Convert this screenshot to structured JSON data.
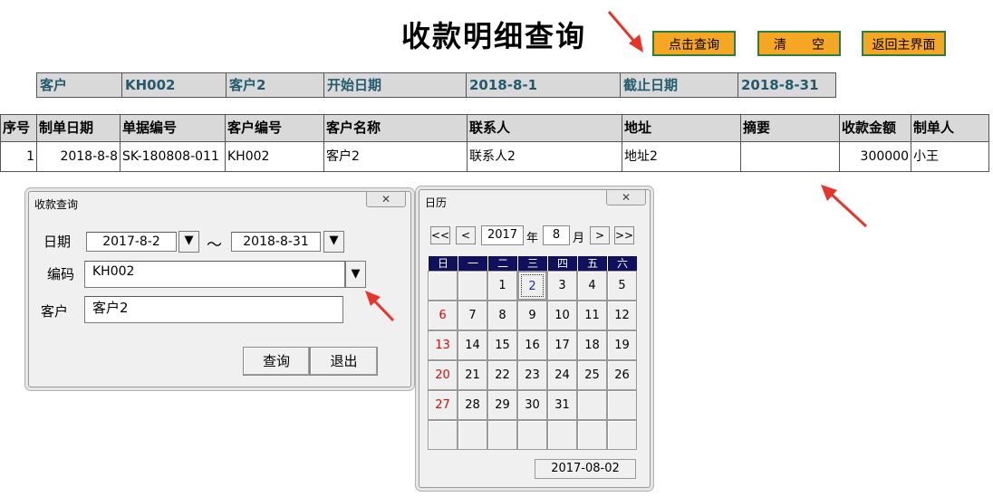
{
  "page": {
    "title": "收款明细查询",
    "buttons": {
      "query": "点击查询",
      "clear": "清　　空",
      "back": "返回主界面"
    }
  },
  "filter": [
    "客户",
    "KH002",
    "客户2",
    "开始日期",
    "2018-8-1",
    "截止日期",
    "2018-8-31"
  ],
  "table": {
    "headers": [
      "序号",
      "制单日期",
      "单据编号",
      "客户编号",
      "客户名称",
      "联系人",
      "地址",
      "摘要",
      "收款金额",
      "制单人"
    ],
    "rows": [
      [
        "1",
        "2018-8-8",
        "SK-180808-011",
        "KH002",
        "客户2",
        "联系人2",
        "地址2",
        "",
        "300000",
        "小王"
      ]
    ]
  },
  "query_dialog": {
    "title": "收款查询",
    "close": "✕",
    "date_label": "日期",
    "date_from": "2017-8-2",
    "tilde": "～",
    "date_to": "2018-8-31",
    "code_label": "编码",
    "code_value": "KH002",
    "customer_label": "客户",
    "customer_value": "客户2",
    "query_btn": "查询",
    "exit_btn": "退出",
    "dropdown_glyph": "▼"
  },
  "calendar": {
    "title": "日历",
    "close": "✕",
    "prev_year": "<<",
    "prev_month": "<",
    "year": "2017",
    "year_label": "年",
    "month": "8",
    "month_label": "月",
    "next_month": ">",
    "next_year": ">>",
    "weekdays": [
      "日",
      "一",
      "二",
      "三",
      "四",
      "五",
      "六"
    ],
    "weeks": [
      [
        "",
        "",
        "1",
        "2",
        "3",
        "4",
        "5"
      ],
      [
        "6",
        "7",
        "8",
        "9",
        "10",
        "11",
        "12"
      ],
      [
        "13",
        "14",
        "15",
        "16",
        "17",
        "18",
        "19"
      ],
      [
        "20",
        "21",
        "22",
        "23",
        "24",
        "25",
        "26"
      ],
      [
        "27",
        "28",
        "29",
        "30",
        "31",
        "",
        ""
      ],
      [
        "",
        "",
        "",
        "",
        "",
        "",
        ""
      ]
    ],
    "selected_day": "2",
    "selected_date": "2017-08-02"
  },
  "colors": {
    "button_bg": "#f5a623",
    "button_border": "#2f7d3a",
    "header_bg": "#d9d9d9",
    "filter_text": "#235b6e",
    "calendar_header": "#10105e",
    "sunday": "#cc1111",
    "arrow": "#e8352b"
  }
}
